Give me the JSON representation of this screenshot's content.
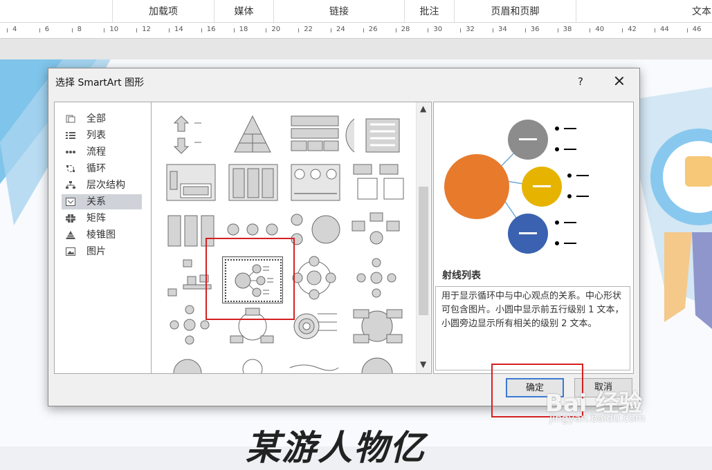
{
  "ribbon": {
    "groups": [
      "加载项",
      "媒体",
      "链接",
      "批注",
      "页眉和页脚",
      "文本"
    ]
  },
  "ruler": {
    "ticks": [
      "4",
      "6",
      "8",
      "10",
      "12",
      "14",
      "16",
      "18",
      "20",
      "22",
      "24",
      "26",
      "28",
      "30",
      "32",
      "34",
      "36",
      "38",
      "40",
      "42",
      "44",
      "46"
    ]
  },
  "document": {
    "title_fragment": "某游人物亿"
  },
  "dialog": {
    "title": "选择 SmartArt 图形",
    "help_label": "?",
    "categories": [
      {
        "label": "全部",
        "icon": "all-icon"
      },
      {
        "label": "列表",
        "icon": "list-icon"
      },
      {
        "label": "流程",
        "icon": "process-icon"
      },
      {
        "label": "循环",
        "icon": "cycle-icon"
      },
      {
        "label": "层次结构",
        "icon": "hierarchy-icon"
      },
      {
        "label": "关系",
        "icon": "relationship-icon"
      },
      {
        "label": "矩阵",
        "icon": "matrix-icon"
      },
      {
        "label": "棱锥图",
        "icon": "pyramid-icon"
      },
      {
        "label": "图片",
        "icon": "picture-icon"
      }
    ],
    "selected_category": "关系",
    "preview": {
      "name": "射线列表",
      "description": "用于显示循环中与中心观点的关系。中心形状可包含图片。小圆中显示前五行级别 1 文本，小圆旁边显示所有相关的级别 2 文本。",
      "bullet": "—"
    },
    "ok_label": "确定",
    "cancel_label": "取消"
  },
  "watermark": {
    "brand": "Bai 经验",
    "url": "jingyan.baidu.com"
  },
  "colors": {
    "accent": "#3b79d3",
    "annotation_red": "#d42020",
    "preview_orange": "#e87a2c",
    "preview_gray": "#8c8c8c",
    "preview_yellow": "#e6b400",
    "preview_blue": "#3a62b0"
  }
}
